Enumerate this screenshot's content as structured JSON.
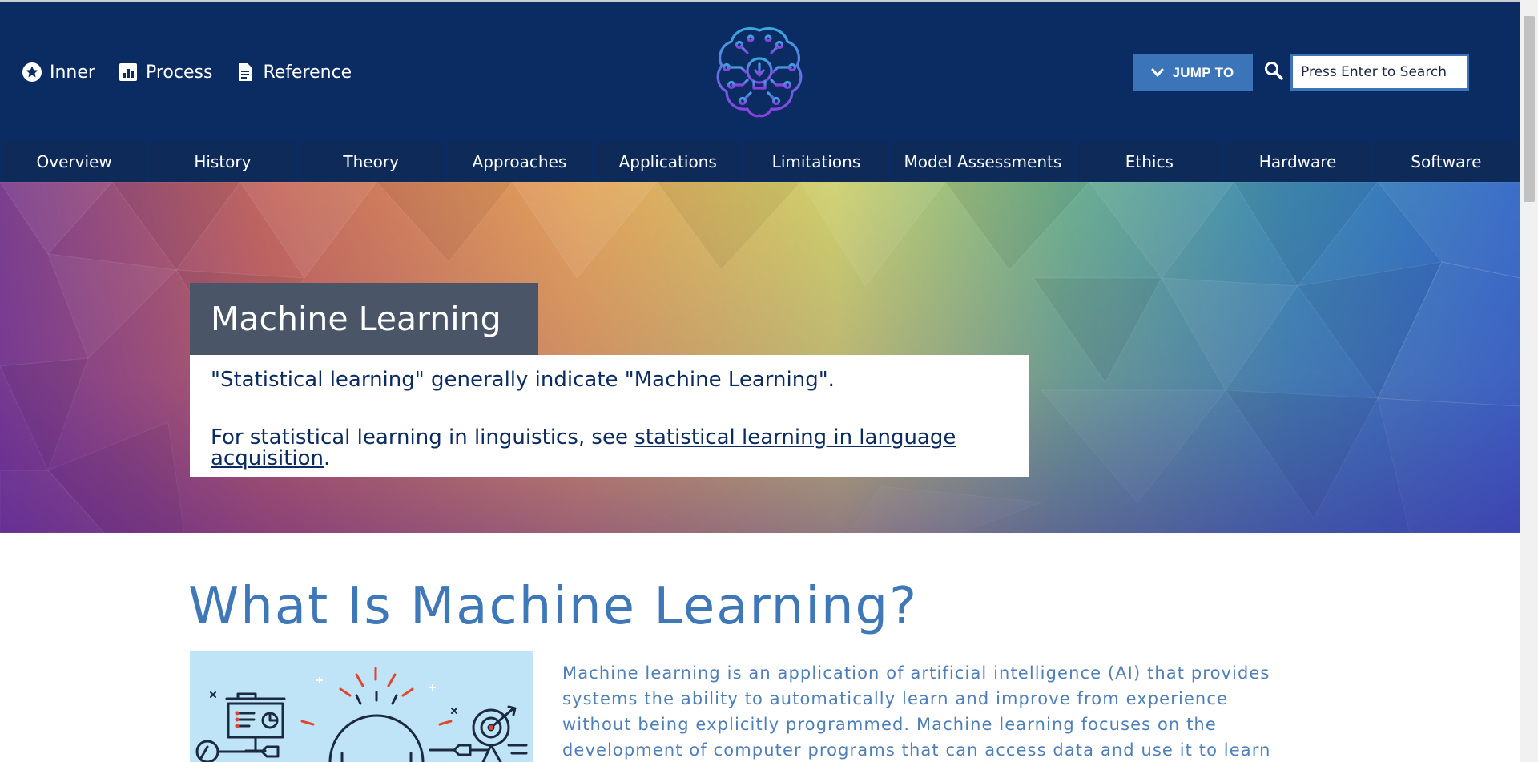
{
  "header": {
    "util_links": [
      {
        "label": "Inner",
        "icon": "star-icon"
      },
      {
        "label": "Process",
        "icon": "chart-icon"
      },
      {
        "label": "Reference",
        "icon": "document-icon"
      }
    ],
    "logo_icon": "brain-circuit-lightbulb-icon",
    "jump_to_label": "JUMP TO",
    "search_placeholder": "Press Enter to Search"
  },
  "nav": {
    "items": [
      "Overview",
      "History",
      "Theory",
      "Approaches",
      "Applications",
      "Limitations",
      "Model Assessments",
      "Ethics",
      "Hardware",
      "Software"
    ]
  },
  "hero": {
    "title": "Machine Learning",
    "note_line1": "\"Statistical learning\" generally indicate \"Machine Learning\".",
    "note_line2_prefix": "For statistical learning in linguistics, see ",
    "note_link": "statistical learning in language acquisition",
    "note_line2_suffix": "."
  },
  "content": {
    "section_title": "What Is Machine Learning?",
    "illustration_icon": "gear-analytics-illustration",
    "intro": "Machine learning is an application of artificial intelligence (AI) that provides systems the ability to automatically learn and improve from experience without being explicitly programmed. Machine learning focuses on the development of computer programs that can access data and use it to learn for themselves."
  },
  "colors": {
    "header_bg": "#0b2b63",
    "accent": "#3b74b9",
    "title_box": "#4a5568",
    "heading": "#3e78b8"
  }
}
